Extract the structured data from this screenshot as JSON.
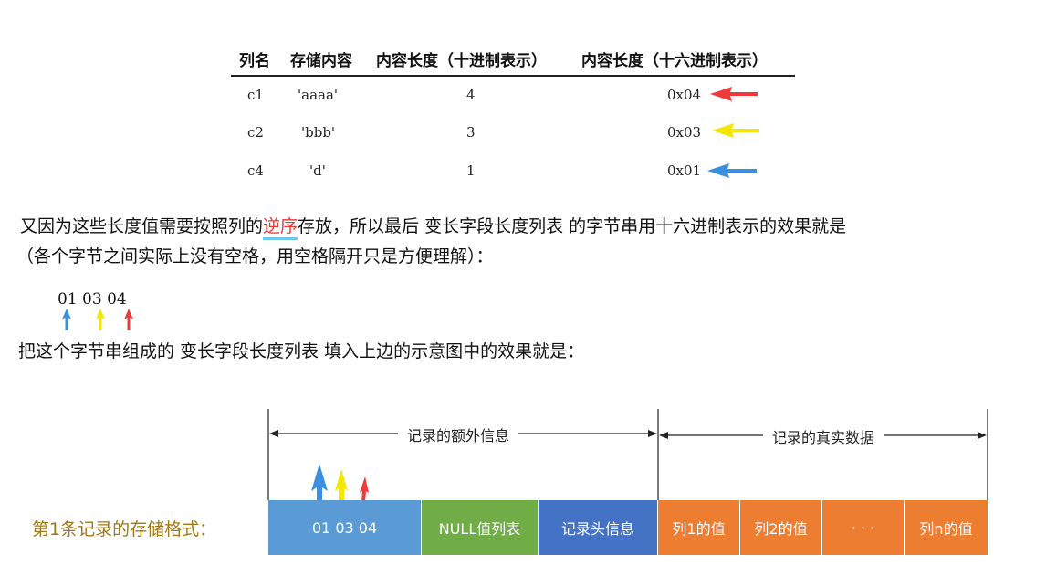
{
  "table": {
    "headers": [
      "列名",
      "存储内容",
      "内容长度（十进制表示）",
      "内容长度（十六进制表示）"
    ],
    "rows": [
      {
        "col": "c1",
        "content": "'aaaa'",
        "len_dec": "4",
        "len_hex": "0x04",
        "arrow_color": "#f03a3a"
      },
      {
        "col": "c2",
        "content": "'bbb'",
        "len_dec": "3",
        "len_hex": "0x03",
        "arrow_color": "#f5e600"
      },
      {
        "col": "c4",
        "content": "'d'",
        "len_dec": "1",
        "len_hex": "0x01",
        "arrow_color": "#3a8fe0"
      }
    ]
  },
  "paragraph1": {
    "part1": "又因为这些长度值需要按照列的",
    "highlight": "逆序",
    "part2": "存放，所以最后",
    "term": " 变长字段长度列表 ",
    "part3": "的字节串用十六进制表示的效果就是"
  },
  "paragraph2": "（各个字节之间实际上没有空格，用空格隔开只是方便理解）：",
  "byte_string": {
    "text": "01 03 04",
    "arrow_colors": [
      "#3a8fe0",
      "#f5e600",
      "#f03a3a"
    ]
  },
  "paragraph3": {
    "part1": "把这个字节串组成的",
    "term": " 变长字段长度列表 ",
    "part2": "填入上边的示意图中的效果就是："
  },
  "diagram": {
    "row_label": "第1条记录的存储格式：",
    "extra_info_label": "记录的额外信息",
    "real_data_label": "记录的真实数据",
    "segments": [
      {
        "label": "01 03 04",
        "color": "#5b9bd5"
      },
      {
        "label": "NULL值列表",
        "color": "#70ad47"
      },
      {
        "label": "记录头信息",
        "color": "#4472c4"
      },
      {
        "label": "列1的值",
        "color": "#ed7d31"
      },
      {
        "label": "列2的值",
        "color": "#ed7d31"
      },
      {
        "label": "· · ·",
        "color": "#ed7d31"
      },
      {
        "label": "列n的值",
        "color": "#ed7d31"
      }
    ],
    "arrow_colors": [
      "#3a8fe0",
      "#f5e600",
      "#f03a3a"
    ]
  }
}
